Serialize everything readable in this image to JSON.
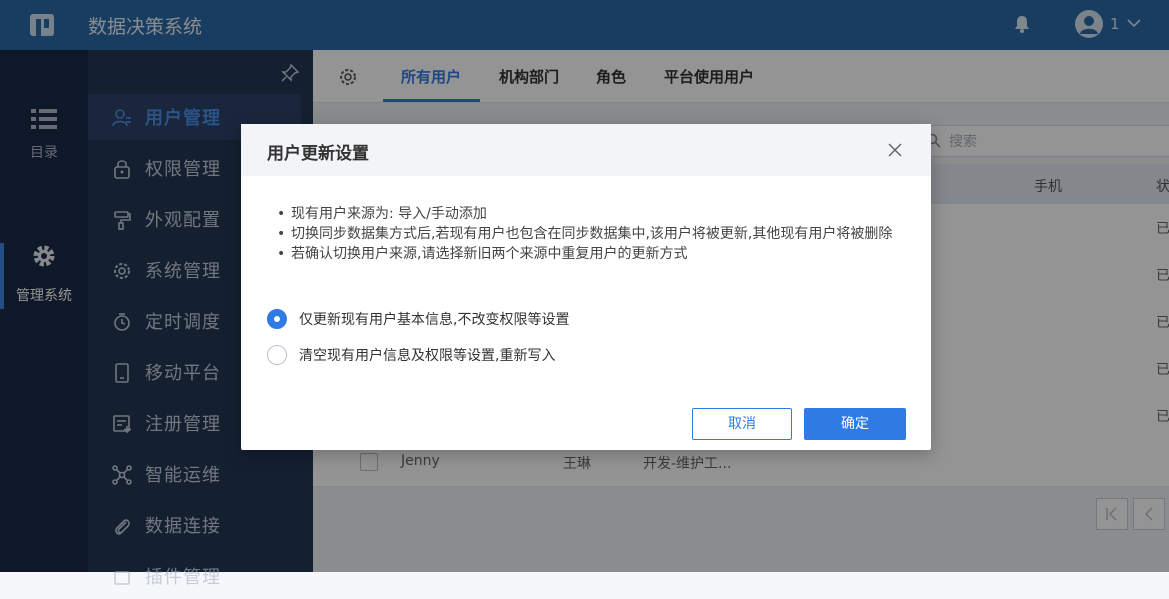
{
  "app": {
    "title": "数据决策系统",
    "user_name": "1"
  },
  "left_nav": [
    {
      "label": "目录",
      "icon": "list-icon",
      "active": false
    },
    {
      "label": "管理系统",
      "icon": "gear-icon",
      "active": true
    }
  ],
  "sub_nav": [
    {
      "label": "用户管理",
      "icon": "user-icon",
      "active": true
    },
    {
      "label": "权限管理",
      "icon": "lock-icon",
      "active": false
    },
    {
      "label": "外观配置",
      "icon": "paint-roller-icon",
      "active": false
    },
    {
      "label": "系统管理",
      "icon": "settings-icon",
      "active": false
    },
    {
      "label": "定时调度",
      "icon": "timer-icon",
      "active": false
    },
    {
      "label": "移动平台",
      "icon": "mobile-icon",
      "active": false
    },
    {
      "label": "注册管理",
      "icon": "register-icon",
      "active": false
    },
    {
      "label": "智能运维",
      "icon": "network-icon",
      "active": false
    },
    {
      "label": "数据连接",
      "icon": "paperclip-icon",
      "active": false
    },
    {
      "label": "插件管理",
      "icon": "plugin-icon",
      "active": false
    }
  ],
  "tabs": [
    {
      "label": "所有用户",
      "active": true
    },
    {
      "label": "机构部门",
      "active": false
    },
    {
      "label": "角色",
      "active": false
    },
    {
      "label": "平台使用用户",
      "active": false
    }
  ],
  "search": {
    "placeholder": "搜索"
  },
  "table": {
    "headers": {
      "phone": "手机",
      "status": "状"
    },
    "status_partial": "已",
    "last_row": {
      "username": "Jenny",
      "name": "王琳",
      "dept": "开发-维护工..."
    }
  },
  "modal": {
    "title": "用户更新设置",
    "notes": [
      "现有用户来源为: 导入/手动添加",
      "切换同步数据集方式后,若现有用户也包含在同步数据集中,该用户将被更新,其他现有用户将被删除",
      "若确认切换用户来源,请选择新旧两个来源中重复用户的更新方式"
    ],
    "options": [
      {
        "label": "仅更新现有用户基本信息,不改变权限等设置",
        "checked": true
      },
      {
        "label": "清空现有用户信息及权限等设置,重新写入",
        "checked": false
      }
    ],
    "cancel_label": "取消",
    "ok_label": "确定"
  },
  "colors": {
    "topbar": "#2c6aa7",
    "accent": "#2f7be4",
    "nav_dark": "#1b2a45",
    "subnav": "#243654"
  }
}
